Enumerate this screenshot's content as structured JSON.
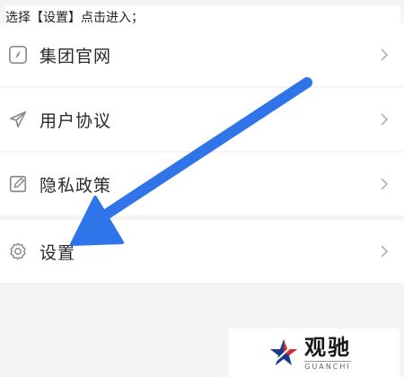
{
  "instruction": "选择【设置】点击进入；",
  "menu": [
    {
      "label": "集团官网",
      "icon": "compass-icon"
    },
    {
      "label": "用户协议",
      "icon": "send-icon"
    },
    {
      "label": "隐私政策",
      "icon": "edit-icon"
    },
    {
      "label": "设置",
      "icon": "gear-icon"
    }
  ],
  "annotation": {
    "arrow_color": "#2f74e8",
    "arrow_icon": "arrow-icon",
    "points_to": "设置"
  },
  "logo": {
    "name_cn": "观驰",
    "name_en": "GUANCHI"
  },
  "colors": {
    "background": "#f4f4f4",
    "row_background": "#ffffff",
    "icon": "#8a8a8a",
    "chevron": "#b5b5b5"
  }
}
